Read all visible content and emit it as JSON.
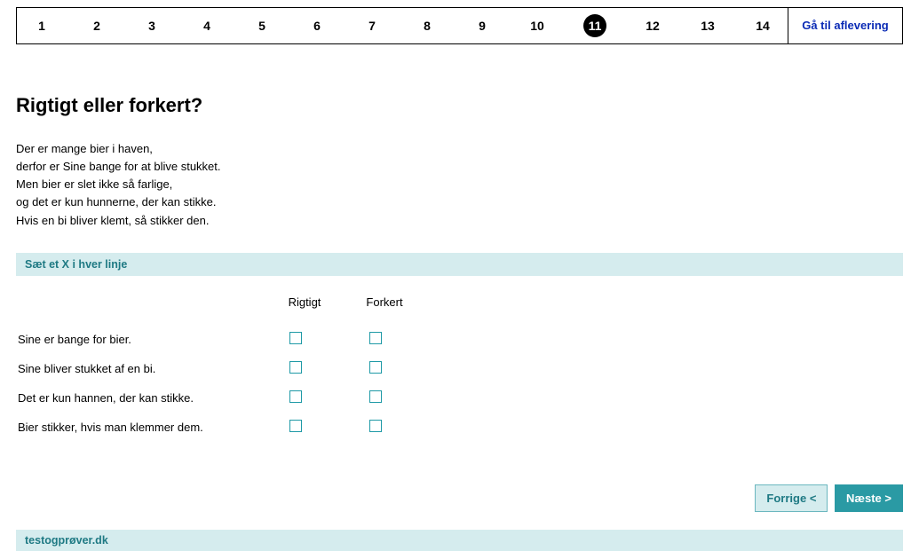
{
  "nav": {
    "items": [
      "1",
      "2",
      "3",
      "4",
      "5",
      "6",
      "7",
      "8",
      "9",
      "10",
      "11",
      "12",
      "13",
      "14"
    ],
    "current_index": 10,
    "deliver_label": "Gå til aflevering"
  },
  "question": {
    "title": "Rigtigt eller forkert?",
    "passage": [
      "Der er mange bier i haven,",
      "derfor er Sine bange for at blive stukket.",
      "Men bier er slet ikke så farlige,",
      "og det er kun hunnerne, der kan stikke.",
      "Hvis en bi bliver klemt, så stikker den."
    ],
    "instruction": "Sæt et X i hver linje",
    "columns": [
      "Rigtigt",
      "Forkert"
    ],
    "rows": [
      "Sine er bange for bier.",
      "Sine bliver stukket af en bi.",
      "Det er kun hannen, der kan stikke.",
      "Bier stikker, hvis man klemmer dem."
    ]
  },
  "buttons": {
    "prev": "Forrige <",
    "next": "Næste >"
  },
  "footer": {
    "site": "testogprøver.dk"
  }
}
